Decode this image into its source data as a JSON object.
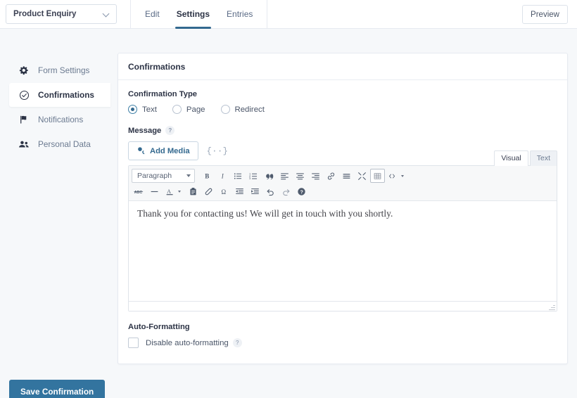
{
  "topbar": {
    "form_selector": {
      "value": "Product Enquiry",
      "icon": "chevron-down-icon"
    },
    "tabs": [
      {
        "label": "Edit",
        "active": false
      },
      {
        "label": "Settings",
        "active": true
      },
      {
        "label": "Entries",
        "active": false
      }
    ],
    "preview_label": "Preview"
  },
  "sidebar": {
    "items": [
      {
        "label": "Form Settings",
        "icon": "gear-icon",
        "active": false
      },
      {
        "label": "Confirmations",
        "icon": "check-circle-icon",
        "active": true
      },
      {
        "label": "Notifications",
        "icon": "flag-icon",
        "active": false
      },
      {
        "label": "Personal Data",
        "icon": "users-icon",
        "active": false
      }
    ]
  },
  "panel": {
    "title": "Confirmations",
    "confirmation_type": {
      "label": "Confirmation Type",
      "options": [
        {
          "label": "Text",
          "selected": true
        },
        {
          "label": "Page",
          "selected": false
        },
        {
          "label": "Redirect",
          "selected": false
        }
      ]
    },
    "message": {
      "label": "Message",
      "help": "?",
      "add_media_label": "Add Media",
      "media_icon": "media-icon",
      "shortcode_icon": "{··}",
      "editor_tabs": [
        {
          "label": "Visual",
          "active": true
        },
        {
          "label": "Text",
          "active": false
        }
      ],
      "toolbar": {
        "format_select": "Paragraph",
        "row1": [
          "bold-icon",
          "italic-icon",
          "bulleted-list-icon",
          "numbered-list-icon",
          "blockquote-icon",
          "align-left-icon",
          "align-center-icon",
          "align-right-icon",
          "link-icon",
          "read-more-icon",
          "distraction-free-icon",
          "table-icon",
          "toolbar-toggle-icon"
        ],
        "row2": [
          "strikethrough-icon",
          "horizontal-rule-icon",
          "text-color-icon",
          "paste-as-text-icon",
          "clear-formatting-icon",
          "special-character-icon",
          "outdent-icon",
          "indent-icon",
          "undo-icon",
          "redo-icon",
          "help-icon"
        ]
      },
      "content": "Thank you for contacting us! We will get in touch with you shortly."
    },
    "auto_formatting": {
      "label": "Auto-Formatting",
      "checkbox_label": "Disable auto-formatting",
      "help": "?",
      "checked": false
    }
  },
  "footer": {
    "save_label": "Save Confirmation"
  },
  "colors": {
    "accent": "#33749f",
    "tab_underline": "#33698f",
    "page_bg": "#f6f8fa",
    "panel_bg": "#ffffff",
    "border": "#e6eaf0",
    "text": "#2c3345",
    "muted": "#6b7a90"
  }
}
